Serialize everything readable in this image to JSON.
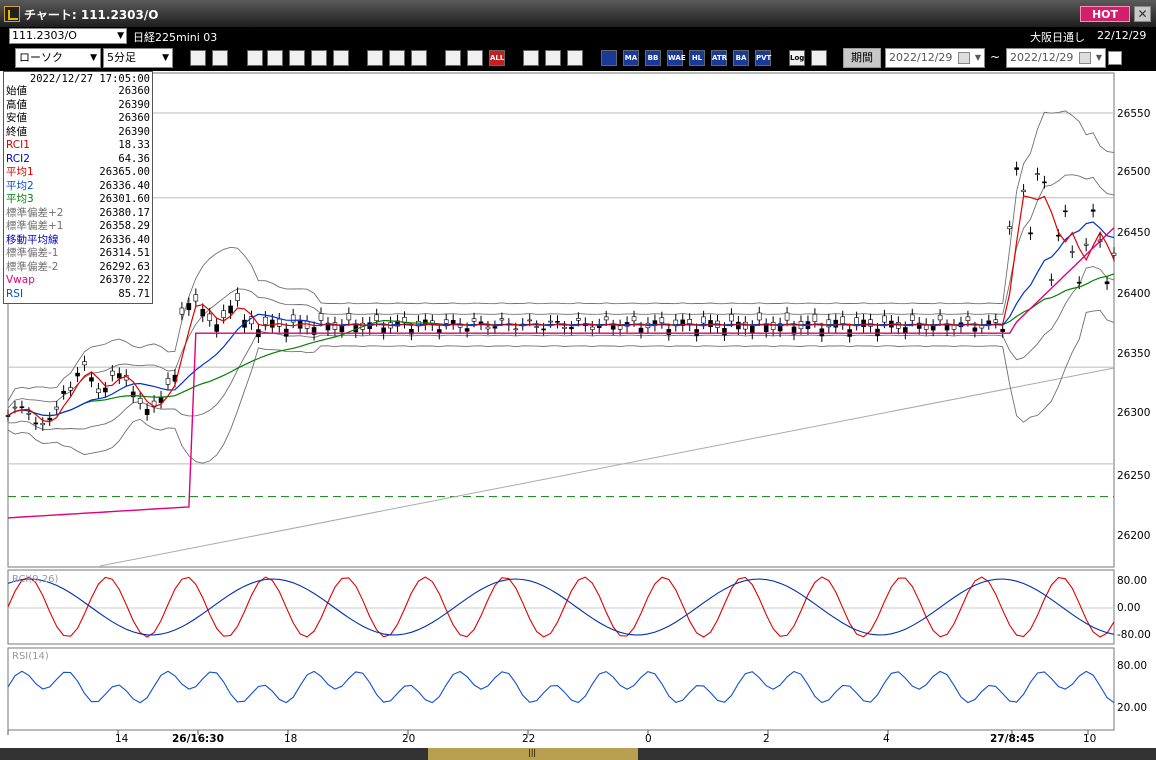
{
  "window": {
    "title": "チャート: 111.2303/O",
    "hot_label": "HOT",
    "close_label": "✕"
  },
  "header": {
    "symbol": "111.2303/O",
    "symbol_name": "日経225mini 03",
    "market": "大阪日通し",
    "date": "22/12/29"
  },
  "toolbar": {
    "chart_type": "ローソク",
    "interval": "5分足",
    "buttons": [
      "zoom",
      "grid",
      "indicator",
      "draw-a",
      "draw-b",
      "draw-c",
      "draw-d",
      "pen",
      "cursor",
      "arrow",
      "hline",
      "vline",
      "all",
      "settings",
      "wrench",
      "color",
      "mdiv",
      "ma",
      "bb",
      "wae",
      "hl",
      "atr",
      "ba",
      "pvt",
      "log",
      "export"
    ],
    "button_labels": {
      "all": "ALL",
      "ma": "MA",
      "bb": "BB",
      "wae": "WAE",
      "hl": "HL",
      "atr": "ATR",
      "ba": "BA",
      "pvt": "PVT",
      "log": "Log"
    },
    "period_label": "期間",
    "date_from": "2022/12/29",
    "date_to": "2022/12/29",
    "tilde": "~"
  },
  "info": {
    "datetime": "2022/12/27  17:05:00",
    "rows": [
      {
        "label": "始値",
        "value": "26360",
        "color": "#000000"
      },
      {
        "label": "高値",
        "value": "26390",
        "color": "#000000"
      },
      {
        "label": "安値",
        "value": "26360",
        "color": "#000000"
      },
      {
        "label": "終値",
        "value": "26390",
        "color": "#000000"
      },
      {
        "label": "RCI1",
        "value": "18.33",
        "color": "#d00000"
      },
      {
        "label": "RCI2",
        "value": "64.36",
        "color": "#0000c0"
      },
      {
        "label": "平均1",
        "value": "26365.00",
        "color": "#e00000"
      },
      {
        "label": "平均2",
        "value": "26336.40",
        "color": "#0050d0"
      },
      {
        "label": "平均3",
        "value": "26301.60",
        "color": "#008000"
      },
      {
        "label": "標準偏差+2",
        "value": "26380.17",
        "color": "#707070"
      },
      {
        "label": "標準偏差+1",
        "value": "26358.29",
        "color": "#707070"
      },
      {
        "label": "移動平均線",
        "value": "26336.40",
        "color": "#0000c0"
      },
      {
        "label": "標準偏差-1",
        "value": "26314.51",
        "color": "#707070"
      },
      {
        "label": "標準偏差-2",
        "value": "26292.63",
        "color": "#707070"
      },
      {
        "label": "Vwap",
        "value": "26370.22",
        "color": "#e0007a"
      },
      {
        "label": "RSI",
        "value": "85.71",
        "color": "#0050d0"
      }
    ]
  },
  "price_axis": [
    "26550",
    "26500",
    "26450",
    "26400",
    "26350",
    "26300",
    "26250",
    "26200"
  ],
  "rci_panel": {
    "label": "RCI(9,26)",
    "ticks": [
      "80.00",
      "0.00",
      "-80.00"
    ]
  },
  "rsi_panel": {
    "label": "RSI(14)",
    "ticks": [
      "80.00",
      "20.00"
    ]
  },
  "time_axis": [
    "14",
    "26/16:30",
    "18",
    "20",
    "22",
    "0",
    "2",
    "4",
    "27/8:45",
    "10"
  ],
  "colors": {
    "ma1": "#e00000",
    "ma2": "#0030d0",
    "ma3": "#008000",
    "vwap": "#e0007a",
    "band": "#707070",
    "rci1": "#e00000",
    "rci2": "#0030b0",
    "rsi": "#1050d0"
  }
}
